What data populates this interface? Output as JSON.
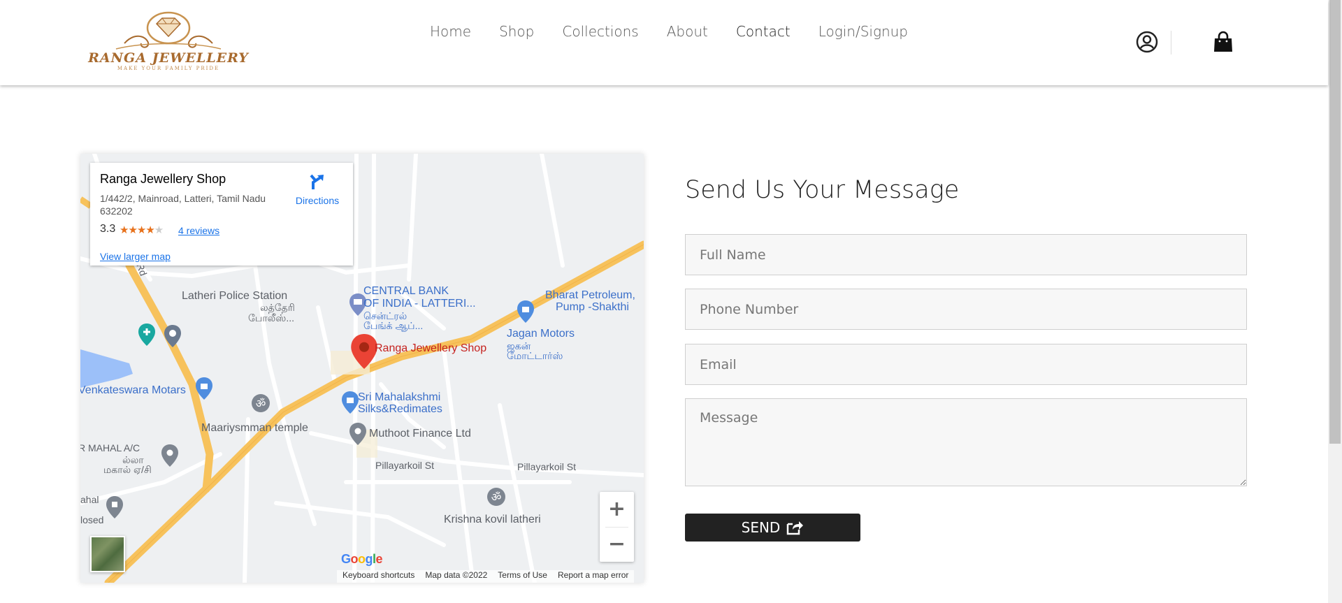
{
  "brand": {
    "name": "RANGA JEWELLERY",
    "tagline": "MAKE YOUR FAMILY PRIDE"
  },
  "nav": {
    "items": [
      {
        "label": "Home"
      },
      {
        "label": "Shop"
      },
      {
        "label": "Collections"
      },
      {
        "label": "About"
      },
      {
        "label": "Contact"
      },
      {
        "label": "Login/Signup"
      }
    ],
    "active": "Contact"
  },
  "header_icons": {
    "account": "user-circle-icon",
    "cart": "shopping-bag-icon"
  },
  "map": {
    "place_name": "Ranga Jewellery Shop",
    "address": "1/442/2, Mainroad, Latteri, Tamil Nadu 632202",
    "rating": "3.3",
    "rating_value": 3.3,
    "reviews": "4 reviews",
    "view_larger": "View larger map",
    "directions": "Directions",
    "zoom_in": "+",
    "zoom_out": "−",
    "google": "Google",
    "attribution": {
      "shortcuts": "Keyboard shortcuts",
      "map_data": "Map data ©2022",
      "terms": "Terms of Use",
      "report": "Report a map error"
    },
    "labels": {
      "police": "Latheri Police Station",
      "police_ta1": "லத்தேரி",
      "police_ta2": "போலீஸ்...",
      "bank1": "CENTRAL BANK",
      "bank2": "OF INDIA -  LATTERI...",
      "bank_ta1": "சென்ட்ரல்",
      "bank_ta2": "பேங்க் ஆப்...",
      "petrol1": "Bharat Petroleum,",
      "petrol2": "Pump -Shakthi",
      "jagan": "Jagan Motors",
      "jagan_ta1": "ஜகன்",
      "jagan_ta2": "மோட்டார்ஸ்",
      "shop_pin": "Ranga Jewellery Shop",
      "venkat": "Venkateswara Motars",
      "temple": "Maariysmman temple",
      "silks1": "Sri Mahalakshmi",
      "silks2": "Silks&Redimates",
      "muthoot": "Muthoot Finance Ltd",
      "mahal": "R MAHAL A/C",
      "mahal_ta1": "ல்லா",
      "mahal_ta2": "மகால் ஏ/சி",
      "pillayar1": "Pillayarkoil St",
      "pillayar2": "Pillayarkoil St",
      "krishna": "Krishna kovil latheri",
      "ahal1": "ahal",
      "ahal2": "losed",
      "road": "ur Rd"
    }
  },
  "form": {
    "title": "Send Us Your Message",
    "full_name_placeholder": "Full Name",
    "phone_placeholder": "Phone Number",
    "email_placeholder": "Email",
    "message_placeholder": "Message",
    "send_label": "SEND"
  }
}
